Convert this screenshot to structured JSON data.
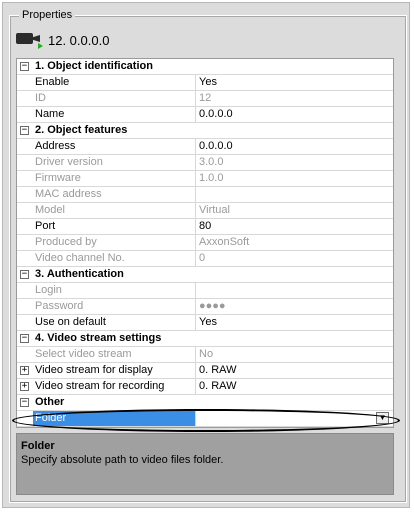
{
  "panel": {
    "title": "Properties"
  },
  "device": {
    "icon": "camera-icon",
    "title": "12. 0.0.0.0"
  },
  "grid": {
    "categories": [
      {
        "label": "1. Object identification",
        "expanded": true,
        "props": [
          {
            "name": "Enable",
            "value": "Yes",
            "disabled": false
          },
          {
            "name": "ID",
            "value": "12",
            "disabled": true
          },
          {
            "name": "Name",
            "value": "0.0.0.0",
            "disabled": false
          }
        ]
      },
      {
        "label": "2. Object features",
        "expanded": true,
        "props": [
          {
            "name": "Address",
            "value": "0.0.0.0",
            "disabled": false
          },
          {
            "name": "Driver version",
            "value": "3.0.0",
            "disabled": true
          },
          {
            "name": "Firmware",
            "value": "1.0.0",
            "disabled": true
          },
          {
            "name": "MAC address",
            "value": "",
            "disabled": true
          },
          {
            "name": "Model",
            "value": "Virtual",
            "disabled": true
          },
          {
            "name": "Port",
            "value": "80",
            "disabled": false
          },
          {
            "name": "Produced by",
            "value": "AxxonSoft",
            "disabled": true
          },
          {
            "name": "Video channel No.",
            "value": "0",
            "disabled": true
          }
        ]
      },
      {
        "label": "3. Authentication",
        "expanded": true,
        "props": [
          {
            "name": "Login",
            "value": "",
            "disabled": true
          },
          {
            "name": "Password",
            "value": "●●●●",
            "disabled": true
          },
          {
            "name": "Use on default",
            "value": "Yes",
            "disabled": false
          }
        ]
      },
      {
        "label": "4. Video stream settings",
        "expanded": true,
        "props": [
          {
            "name": "Select video stream",
            "value": "No",
            "disabled": true
          },
          {
            "name": "Video stream for display",
            "value": "0. RAW",
            "disabled": false,
            "expandable": true
          },
          {
            "name": "Video stream for recording",
            "value": "0. RAW",
            "disabled": false,
            "expandable": true
          }
        ]
      },
      {
        "label": "Other",
        "expanded": true,
        "props": [
          {
            "name": "Folder",
            "value": "",
            "disabled": false,
            "selected": true,
            "dropdown": true
          }
        ]
      }
    ]
  },
  "description": {
    "title": "Folder",
    "text": "Specify absolute path to video files folder."
  },
  "symbols": {
    "collapse": "−",
    "expand": "+",
    "dropdown": "▼"
  }
}
